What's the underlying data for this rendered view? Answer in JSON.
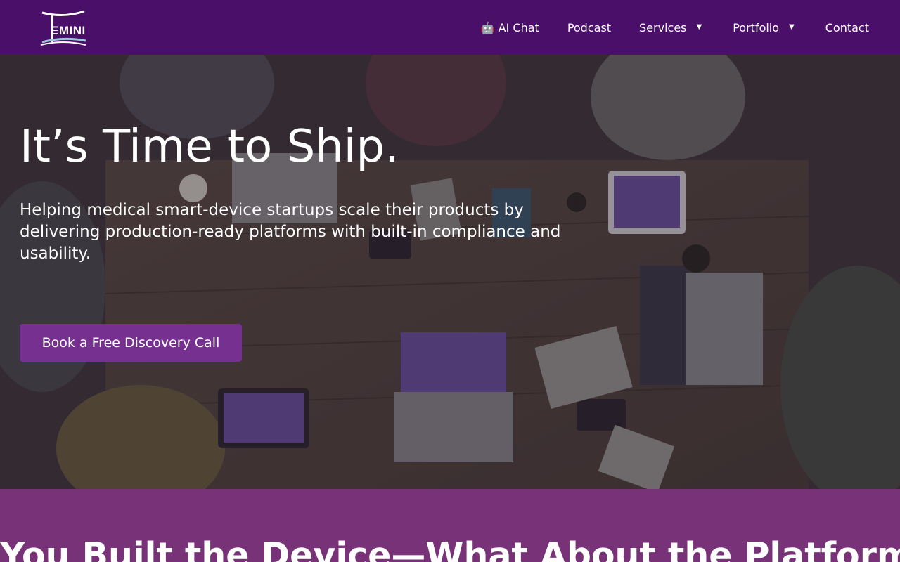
{
  "brand": {
    "logo_text": "EMINI",
    "logo_name": "Gemini logo"
  },
  "nav": {
    "ai_chat": {
      "icon": "robot-icon",
      "label": "AI Chat"
    },
    "podcast": "Podcast",
    "services": "Services",
    "portfolio": "Portfolio",
    "contact": "Contact"
  },
  "hero": {
    "title": "It’s Time to Ship.",
    "subtitle": "Helping medical smart-device startups scale their products by delivering production-ready platforms with built-in compliance and usability.",
    "cta": "Book a Free Discovery Call",
    "background": "photo of team working around a table with laptops and tablets"
  },
  "section2": {
    "title": "You Built the Device—What About the Platform?"
  },
  "colors": {
    "nav_bg": "#4a0f68",
    "cta_bg": "#76308f",
    "section_bg": "#783378"
  }
}
